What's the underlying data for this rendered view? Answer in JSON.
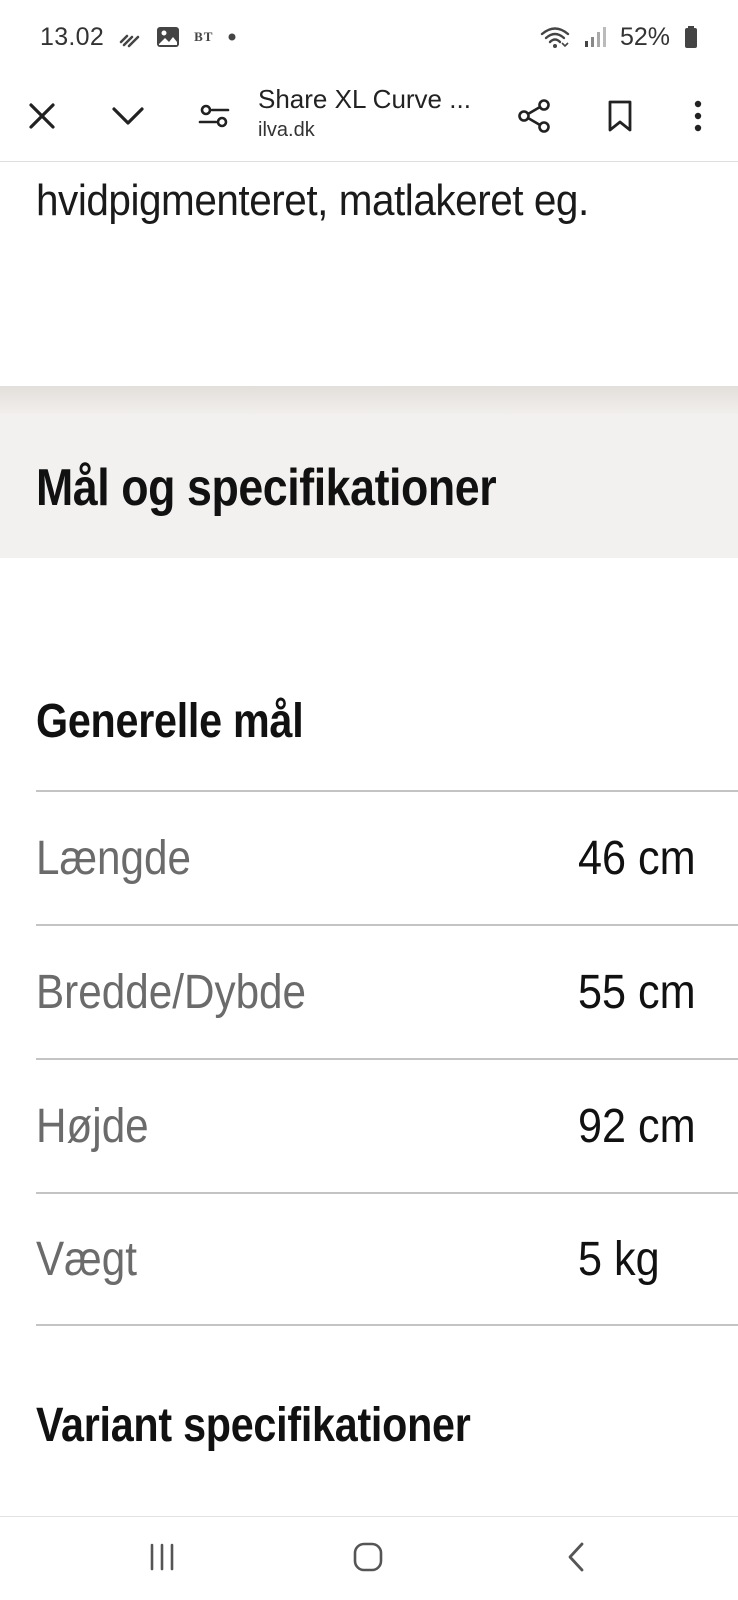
{
  "status_bar": {
    "time": "13.02",
    "notification_icons": [
      "signal-waves-icon",
      "gallery-icon",
      "bt-app-icon",
      "dot-icon"
    ],
    "bt_label": "BT",
    "battery_percent": "52%"
  },
  "toolbar": {
    "page_title": "Share XL Curve ...",
    "url": "ilva.dk"
  },
  "content": {
    "description_line": "hvidpigmenteret, matlakeret eg.",
    "section_title": "Mål og specifikationer",
    "general_title": "Generelle mål",
    "specs": [
      {
        "label": "Længde",
        "value": "46 cm"
      },
      {
        "label": "Bredde/Dybde",
        "value": "55 cm"
      },
      {
        "label": "Højde",
        "value": "92 cm"
      },
      {
        "label": "Vægt",
        "value": "5 kg"
      }
    ],
    "variant_title": "Variant specifikationer"
  },
  "colors": {
    "section_band": "#f2f1ef",
    "divider": "#c4c4c4",
    "label_gray": "#6b6b6b",
    "text_dark": "#111111"
  }
}
